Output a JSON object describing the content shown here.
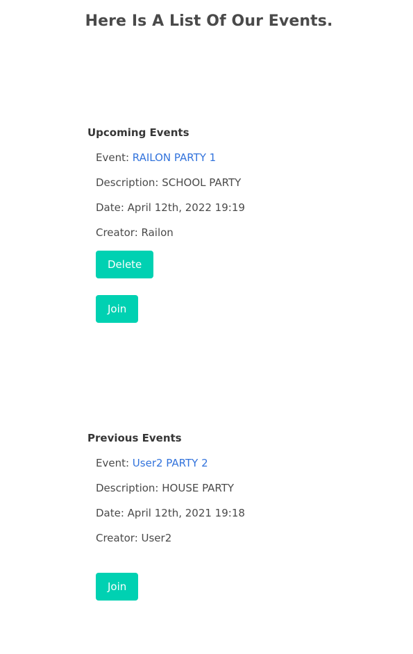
{
  "page": {
    "title": "Here Is A List Of Our Events."
  },
  "upcoming": {
    "heading": "Upcoming Events",
    "event": {
      "event_label": "Event: ",
      "event_name": "RAILON PARTY 1",
      "description": "Description: SCHOOL PARTY",
      "date": "Date: April 12th, 2022 19:19",
      "creator": "Creator: Railon",
      "delete_label": "Delete",
      "join_label": "Join"
    }
  },
  "previous": {
    "heading": "Previous Events",
    "event": {
      "event_label": "Event: ",
      "event_name": "User2 PARTY 2",
      "description": "Description: HOUSE PARTY",
      "date": "Date: April 12th, 2021 19:18",
      "creator": "Creator: User2",
      "join_label": "Join"
    }
  },
  "colors": {
    "accent_button": "#00d1b2",
    "link": "#3273dc",
    "text": "#4a4a4a"
  }
}
